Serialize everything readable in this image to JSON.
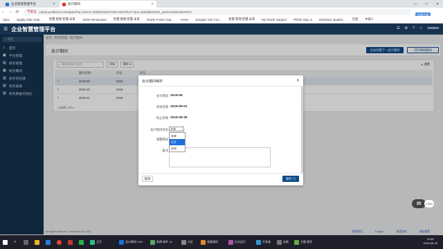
{
  "browser": {
    "tabs": [
      {
        "title": "企业智能管理平台",
        "active": false
      },
      {
        "title": "会计期间",
        "active": true
      }
    ],
    "window_controls": [
      "—",
      "□",
      "✕"
    ],
    "nav": {
      "back": "←",
      "forward": "→",
      "reload": "⟳",
      "home": "⌂"
    },
    "security": "不安全",
    "url": "cloud.yunhitech.com/apex/f?p=100:47:10300016247248::NO:RP,47::&cs=33e4fb00dVR_uDZGoOZ5zZ57WYA",
    "translate_badge": "在线工具"
  },
  "bookmarks": [
    "Apex",
    "supply chain man...",
    "智慧,管理,智慧,未来",
    "JSON Introduction",
    "智慧,管理,智慧,未来",
    "Oracle Fusion Sup...",
    "Home",
    "Douglas Volz Con...",
    "智慧,管理,智慧,未来",
    "My Oracle Support",
    "PROD Sign In",
    "McKinsey Quarter...",
    "百度",
    "中国人"
  ],
  "app": {
    "title": "企业智慧管理平台",
    "header_right": [
      "☰",
      "⚙",
      "?",
      "☆",
      "venture"
    ]
  },
  "sidebar": {
    "search_placeholder": "导航",
    "items": [
      {
        "icon": "⌂",
        "label": "首页"
      },
      {
        "icon": "▣",
        "label": "平台管理"
      },
      {
        "icon": "▤",
        "label": "财务管理"
      },
      {
        "icon": "▦",
        "label": "财务期间"
      },
      {
        "icon": "▥",
        "label": "财务供应链"
      },
      {
        "icon": "▧",
        "label": "财务报表"
      },
      {
        "icon": "▨",
        "label": "财务数据可视化"
      }
    ]
  },
  "breadcrumb": "首页 › 财务管理 › 会计期间",
  "page": {
    "title": "会计期间",
    "btn_generate": "自动创建下一会计期间",
    "btn_open": "打开审批期间"
  },
  "grid": {
    "search_placeholder": "搜索 所有文本列",
    "btn_go": "开始",
    "btn_actions": "操作 ▾",
    "btn_reset": "重置",
    "columns": [
      "",
      "期间名称 ↑",
      "年份",
      "序号"
    ],
    "rows": [
      {
        "period": "2019-09",
        "year": "2019",
        "seq": "9",
        "selected": true
      },
      {
        "period": "2019-10",
        "year": "2019",
        "seq": "10",
        "selected": false
      },
      {
        "period": "2019-11",
        "year": "2019",
        "seq": "11",
        "selected": false
      }
    ],
    "footer": "已选择 1 共 3"
  },
  "modal": {
    "title": "会计期间维护",
    "fields": {
      "period_label": "会计期间",
      "period_value": "2019-09",
      "start_label": "开始日期",
      "start_value": "2019-09-01",
      "end_label": "终止日期",
      "end_value": "2019-09-30",
      "status_label": "会计期间状态",
      "status_value": "未来",
      "adjust_label": "调整期间",
      "note_label": "备注"
    },
    "status_options": [
      "未来",
      "打开",
      "关闭"
    ],
    "highlighted_option": "打开",
    "btn_cancel": "取消",
    "btn_save": "保存 ▤"
  },
  "footer": {
    "copyright": "All rights reserved. YunHitech Inc.2018",
    "links": [
      "联系我们",
      "English",
      "使用条款",
      "隐私政策"
    ]
  },
  "badge": {
    "label": "30",
    "pct": "0.3K/s"
  },
  "taskbar": {
    "items": [
      "Windows",
      "搜索",
      "文件",
      "Edge",
      "Chrome",
      "WPS",
      "微信",
      "主页",
      "会计期间 10%",
      "新建 邮件 10",
      "分区",
      "查看源码",
      "后台运行",
      "开发者",
      "安装",
      "主题 颜色"
    ],
    "time": "11:02",
    "date": "2019-09-23"
  },
  "colors": {
    "header_bg": "#17324f",
    "primary": "#0d4a8a",
    "highlight": "#1e6fd9"
  }
}
